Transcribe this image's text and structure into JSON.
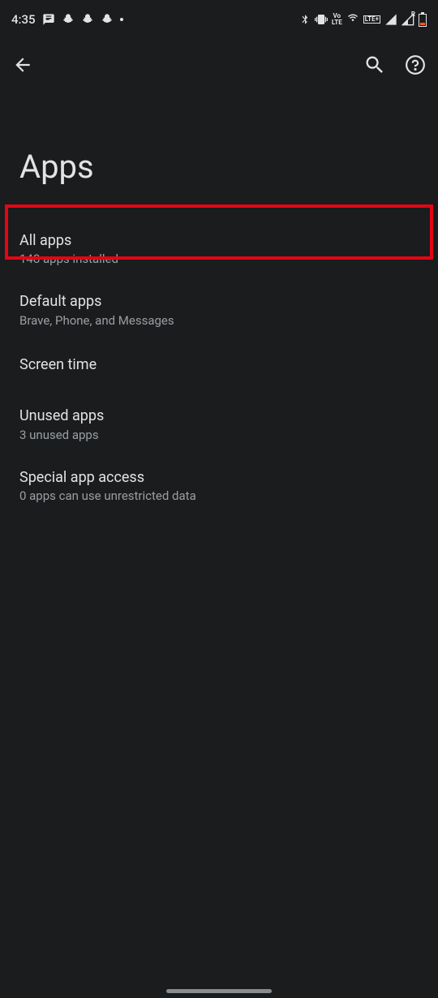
{
  "status_bar": {
    "time": "4:35",
    "notifications": [
      "message",
      "snapchat",
      "snapchat",
      "snapchat",
      "more"
    ],
    "right_icons": {
      "bluetooth": true,
      "vibrate": true,
      "volte": "Vo LTE",
      "hotspot": true,
      "lte_plus": "LTE+",
      "signal": true,
      "signal_r": "R",
      "battery_low": true
    }
  },
  "action_bar": {
    "back": "back",
    "search": "search",
    "help": "help"
  },
  "page_title": "Apps",
  "items": [
    {
      "title": "All apps",
      "subtitle": "148 apps installed",
      "highlighted": true
    },
    {
      "title": "Default apps",
      "subtitle": "Brave, Phone, and Messages"
    },
    {
      "title": "Screen time",
      "subtitle": ""
    },
    {
      "title": "Unused apps",
      "subtitle": "3 unused apps"
    },
    {
      "title": "Special app access",
      "subtitle": "0 apps can use unrestricted data"
    }
  ]
}
